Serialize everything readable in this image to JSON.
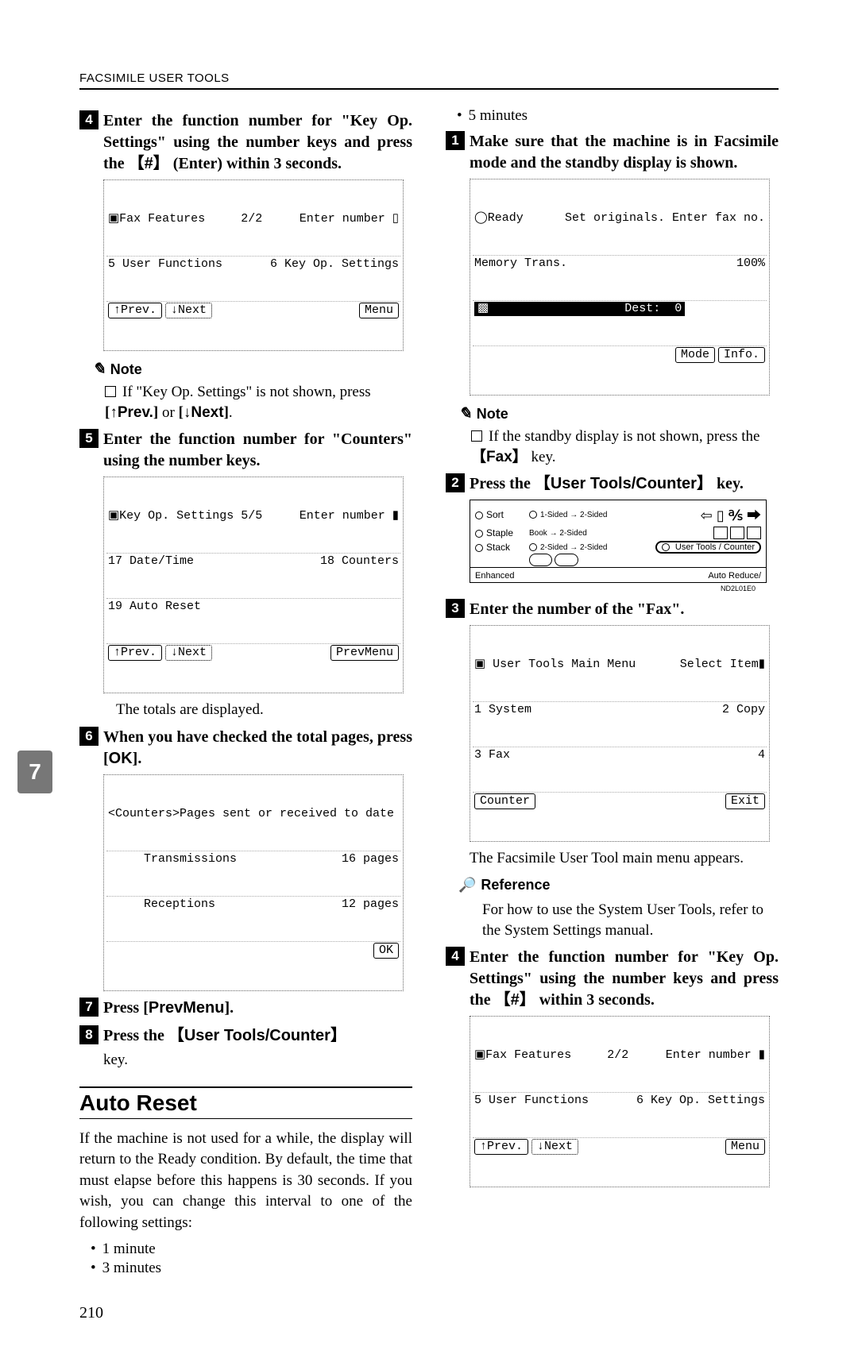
{
  "header": "FACSIMILE USER TOOLS",
  "side_tab": "7",
  "page_number": "210",
  "left": {
    "step4": {
      "num": "4",
      "text_a": "Enter the function number for \"Key Op. Settings\" using the number keys and press the ",
      "key": "#",
      "text_b": " (Enter) within 3 seconds."
    },
    "lcd4": {
      "r1l": "▣Fax Features     2/2",
      "r1r": "Enter number ▯",
      "r2l": "5 User Functions",
      "r2r": "6 Key Op. Settings",
      "b1": "↑Prev.",
      "b2": "↓Next",
      "b3": "Menu"
    },
    "note4_head": "Note",
    "note4_body_a": "If \"Key Op. Settings\" is not shown, press ",
    "note4_key1": "↑Prev.",
    "note4_mid": " or ",
    "note4_key2": "↓Next",
    "step5": {
      "num": "5",
      "text": "Enter the function number for \"Counters\" using the number keys."
    },
    "lcd5": {
      "r1l": "▣Key Op. Settings 5/5",
      "r1r": "Enter number ▮",
      "r2l": "17 Date/Time",
      "r2r": "18 Counters",
      "r3l": "19 Auto Reset",
      "b1": "↑Prev.",
      "b2": "↓Next",
      "b3": "PrevMenu"
    },
    "totals": "The totals are displayed.",
    "step6": {
      "num": "6",
      "text_a": "When you have checked the total pages, press ",
      "key": "OK"
    },
    "lcd6": {
      "r1": "<Counters>Pages sent or received to date",
      "r2l": "     Transmissions",
      "r2r": "16 pages",
      "r3l": "     Receptions",
      "r3r": "12 pages",
      "b1": "OK"
    },
    "step7": {
      "num": "7",
      "text_a": "Press ",
      "key": "PrevMenu"
    },
    "step8": {
      "num": "8",
      "text_a": "Press the ",
      "key": "User Tools/Counter",
      "tail": "key."
    },
    "section": "Auto Reset",
    "section_text": "If the machine is not used for a while, the display will return to the Ready condition. By default, the time that must elapse before this happens is 30 seconds. If you wish, you can change this interval to one of the following settings:",
    "bullets": [
      "1 minute",
      "3 minutes"
    ]
  },
  "right": {
    "bullets_top": [
      "5 minutes"
    ],
    "step1": {
      "num": "1",
      "text": "Make sure that the machine is in Facsimile mode and the standby display is shown."
    },
    "lcd1": {
      "r1l": "◯Ready",
      "r1r": "Set originals. Enter fax no.",
      "r2l": "Memory Trans.",
      "r2r": "100%",
      "r3l": "▩                   Dest:  0",
      "b1": "Mode",
      "b2": "Info."
    },
    "note1_head": "Note",
    "note1_body_a": "If the standby display is not shown, press the ",
    "note1_key": "Fax",
    "note1_body_b": " key.",
    "step2": {
      "num": "2",
      "text_a": "Press the ",
      "key": "User Tools/Counter",
      "text_b": " key."
    },
    "panel": {
      "rows": [
        "Sort",
        "Staple",
        "Stack"
      ],
      "col2": [
        "1-Sided → 2-Sided",
        "Book → 2-Sided",
        "2-Sided → 2-Sided"
      ],
      "ring": "User Tools / Counter",
      "foot_l": "Enhanced",
      "foot_r": "Auto Reduce/"
    },
    "img_code": "ND2L01E0",
    "step3": {
      "num": "3",
      "text": "Enter the number of the \"Fax\"."
    },
    "lcd3": {
      "r1l": "▣ User Tools Main Menu",
      "r1r": "Select Item▮",
      "r2a": "1 System",
      "r2b": "2 Copy",
      "r3a": "3 Fax",
      "r3b": "4",
      "b1": "Counter",
      "b2": "Exit"
    },
    "aftermenu": "The Facsimile User Tool main menu appears.",
    "ref_head": "Reference",
    "ref_body": "For how to use the System User Tools, refer to the System Settings manual.",
    "step4r": {
      "num": "4",
      "text_a": "Enter the function number for \"Key Op. Settings\" using the number keys and press the ",
      "key": "#",
      "text_b": " within 3 seconds."
    },
    "lcd4r": {
      "r1l": "▣Fax Features     2/2",
      "r1r": "Enter number ▮",
      "r2l": "5 User Functions",
      "r2r": "6 Key Op. Settings",
      "b1": "↑Prev.",
      "b2": "↓Next",
      "b3": "Menu"
    }
  }
}
